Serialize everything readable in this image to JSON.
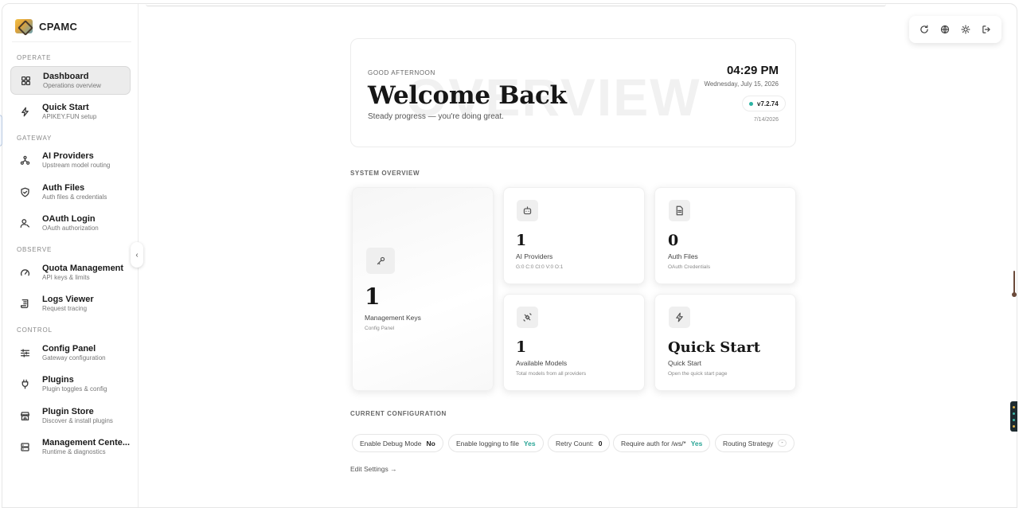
{
  "brand": {
    "name": "CPAMC"
  },
  "sidebar": {
    "sections": [
      {
        "label": "OPERATE"
      },
      {
        "label": "GATEWAY"
      },
      {
        "label": "OBSERVE"
      },
      {
        "label": "CONTROL"
      }
    ],
    "items": [
      {
        "title": "Dashboard",
        "subtitle": "Operations overview",
        "icon": "grid-icon",
        "active": true
      },
      {
        "title": "Quick Start",
        "subtitle": "APIKEY.FUN setup",
        "icon": "bolt-icon"
      },
      {
        "title": "AI Providers",
        "subtitle": "Upstream model routing",
        "icon": "network-icon"
      },
      {
        "title": "Auth Files",
        "subtitle": "Auth files & credentials",
        "icon": "shield-icon"
      },
      {
        "title": "OAuth Login",
        "subtitle": "OAuth authorization",
        "icon": "user-key-icon"
      },
      {
        "title": "Quota Management",
        "subtitle": "API keys & limits",
        "icon": "gauge-icon"
      },
      {
        "title": "Logs Viewer",
        "subtitle": "Request tracing",
        "icon": "scroll-icon"
      },
      {
        "title": "Config Panel",
        "subtitle": "Gateway configuration",
        "icon": "sliders-icon"
      },
      {
        "title": "Plugins",
        "subtitle": "Plugin toggles & config",
        "icon": "plug-icon"
      },
      {
        "title": "Plugin Store",
        "subtitle": "Discover & install plugins",
        "icon": "store-icon"
      },
      {
        "title": "Management Cente...",
        "subtitle": "Runtime & diagnostics",
        "icon": "server-icon"
      }
    ]
  },
  "toolbar": {
    "buttons": [
      {
        "icon": "refresh-icon"
      },
      {
        "icon": "globe-icon"
      },
      {
        "icon": "sun-icon"
      },
      {
        "icon": "logout-icon"
      }
    ]
  },
  "hero": {
    "greeting": "GOOD AFTERNOON",
    "title": "Welcome Back",
    "subtitle": "Steady progress — you're doing great.",
    "watermark": "OVERVIEW",
    "time": "04:29 PM",
    "date": "Wednesday, July 15, 2026",
    "version": "v7.2.74",
    "small_date": "7/14/2026"
  },
  "system_overview": {
    "heading": "SYSTEM OVERVIEW",
    "cards": [
      {
        "value": "1",
        "label": "Management Keys",
        "sub": "Config Panel",
        "icon": "key-icon"
      },
      {
        "value": "1",
        "label": "AI Providers",
        "sub": "G:0 C:0 Cl:0 V:0 O:1",
        "icon": "robot-icon"
      },
      {
        "value": "0",
        "label": "Auth Files",
        "sub": "OAuth Credentials",
        "icon": "file-icon"
      },
      {
        "value": "1",
        "label": "Available Models",
        "sub": "Total models from all providers",
        "icon": "satellite-icon"
      },
      {
        "value": "Quick Start",
        "label": "Quick Start",
        "sub": "Open the quick start page",
        "icon": "bolt-icon"
      }
    ]
  },
  "current_configuration": {
    "heading": "CURRENT CONFIGURATION",
    "items": [
      {
        "label": "Enable Debug Mode",
        "value": "No"
      },
      {
        "label": "Enable logging to file",
        "value": "Yes"
      },
      {
        "label": "Retry Count:",
        "value": "0"
      },
      {
        "label": "Require auth for /ws/*",
        "value": "Yes"
      },
      {
        "label": "Routing Strategy",
        "value": "-"
      }
    ],
    "edit_link": "Edit Settings →"
  },
  "colors": {
    "accent_teal": "#2bb3a3",
    "active_bg": "#ececec"
  }
}
